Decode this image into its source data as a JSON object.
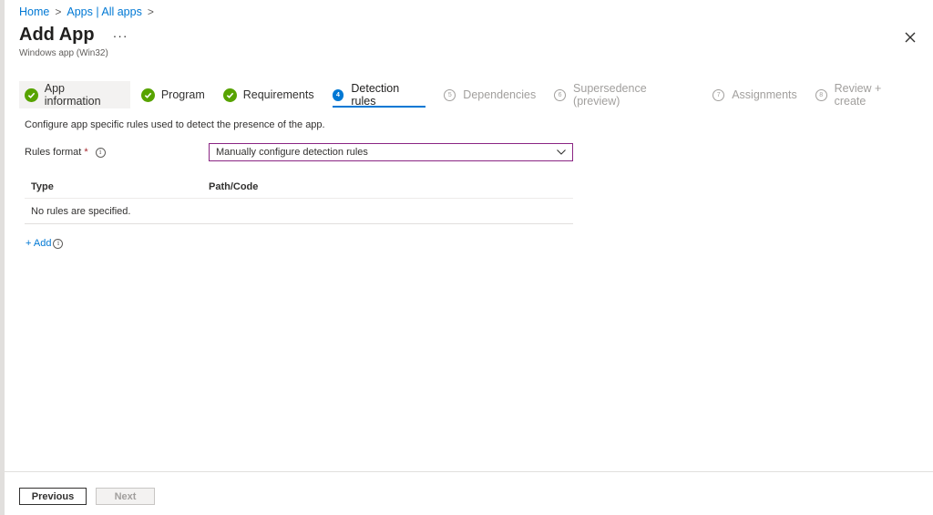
{
  "breadcrumb": {
    "items": [
      "Home",
      "Apps | All apps"
    ],
    "separator": ">"
  },
  "header": {
    "title": "Add App",
    "more": "···",
    "subtitle": "Windows app (Win32)",
    "close_icon": "close-icon"
  },
  "steps": [
    {
      "label": "App information",
      "state": "complete",
      "marker": ""
    },
    {
      "label": "Program",
      "state": "complete",
      "marker": ""
    },
    {
      "label": "Requirements",
      "state": "complete",
      "marker": ""
    },
    {
      "label": "Detection rules",
      "state": "current",
      "marker": "4"
    },
    {
      "label": "Dependencies",
      "state": "pending",
      "marker": "5"
    },
    {
      "label": "Supersedence (preview)",
      "state": "pending",
      "marker": "6"
    },
    {
      "label": "Assignments",
      "state": "pending",
      "marker": "7"
    },
    {
      "label": "Review + create",
      "state": "pending",
      "marker": "8"
    }
  ],
  "main": {
    "description": "Configure app specific rules used to detect the presence of the app.",
    "rules_format": {
      "label": "Rules format",
      "required_mark": "*",
      "info": "i",
      "selected": "Manually configure detection rules"
    },
    "table": {
      "columns": [
        "Type",
        "Path/Code"
      ],
      "empty_text": "No rules are specified."
    },
    "add_label": "+ Add",
    "add_info": "i"
  },
  "footer": {
    "previous_label": "Previous",
    "next_label": "Next"
  },
  "colors": {
    "accent": "#0078d4",
    "complete": "#57a300",
    "dropdown_border": "#8a2583",
    "required": "#a4262c"
  }
}
